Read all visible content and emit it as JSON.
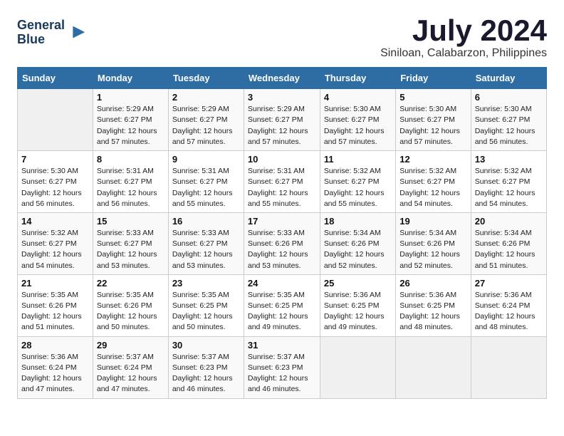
{
  "header": {
    "logo_line1": "General",
    "logo_line2": "Blue",
    "month": "July 2024",
    "location": "Siniloan, Calabarzon, Philippines"
  },
  "weekdays": [
    "Sunday",
    "Monday",
    "Tuesday",
    "Wednesday",
    "Thursday",
    "Friday",
    "Saturday"
  ],
  "weeks": [
    [
      {
        "day": "",
        "info": ""
      },
      {
        "day": "1",
        "info": "Sunrise: 5:29 AM\nSunset: 6:27 PM\nDaylight: 12 hours\nand 57 minutes."
      },
      {
        "day": "2",
        "info": "Sunrise: 5:29 AM\nSunset: 6:27 PM\nDaylight: 12 hours\nand 57 minutes."
      },
      {
        "day": "3",
        "info": "Sunrise: 5:29 AM\nSunset: 6:27 PM\nDaylight: 12 hours\nand 57 minutes."
      },
      {
        "day": "4",
        "info": "Sunrise: 5:30 AM\nSunset: 6:27 PM\nDaylight: 12 hours\nand 57 minutes."
      },
      {
        "day": "5",
        "info": "Sunrise: 5:30 AM\nSunset: 6:27 PM\nDaylight: 12 hours\nand 57 minutes."
      },
      {
        "day": "6",
        "info": "Sunrise: 5:30 AM\nSunset: 6:27 PM\nDaylight: 12 hours\nand 56 minutes."
      }
    ],
    [
      {
        "day": "7",
        "info": "Sunrise: 5:30 AM\nSunset: 6:27 PM\nDaylight: 12 hours\nand 56 minutes."
      },
      {
        "day": "8",
        "info": "Sunrise: 5:31 AM\nSunset: 6:27 PM\nDaylight: 12 hours\nand 56 minutes."
      },
      {
        "day": "9",
        "info": "Sunrise: 5:31 AM\nSunset: 6:27 PM\nDaylight: 12 hours\nand 55 minutes."
      },
      {
        "day": "10",
        "info": "Sunrise: 5:31 AM\nSunset: 6:27 PM\nDaylight: 12 hours\nand 55 minutes."
      },
      {
        "day": "11",
        "info": "Sunrise: 5:32 AM\nSunset: 6:27 PM\nDaylight: 12 hours\nand 55 minutes."
      },
      {
        "day": "12",
        "info": "Sunrise: 5:32 AM\nSunset: 6:27 PM\nDaylight: 12 hours\nand 54 minutes."
      },
      {
        "day": "13",
        "info": "Sunrise: 5:32 AM\nSunset: 6:27 PM\nDaylight: 12 hours\nand 54 minutes."
      }
    ],
    [
      {
        "day": "14",
        "info": "Sunrise: 5:32 AM\nSunset: 6:27 PM\nDaylight: 12 hours\nand 54 minutes."
      },
      {
        "day": "15",
        "info": "Sunrise: 5:33 AM\nSunset: 6:27 PM\nDaylight: 12 hours\nand 53 minutes."
      },
      {
        "day": "16",
        "info": "Sunrise: 5:33 AM\nSunset: 6:27 PM\nDaylight: 12 hours\nand 53 minutes."
      },
      {
        "day": "17",
        "info": "Sunrise: 5:33 AM\nSunset: 6:26 PM\nDaylight: 12 hours\nand 53 minutes."
      },
      {
        "day": "18",
        "info": "Sunrise: 5:34 AM\nSunset: 6:26 PM\nDaylight: 12 hours\nand 52 minutes."
      },
      {
        "day": "19",
        "info": "Sunrise: 5:34 AM\nSunset: 6:26 PM\nDaylight: 12 hours\nand 52 minutes."
      },
      {
        "day": "20",
        "info": "Sunrise: 5:34 AM\nSunset: 6:26 PM\nDaylight: 12 hours\nand 51 minutes."
      }
    ],
    [
      {
        "day": "21",
        "info": "Sunrise: 5:35 AM\nSunset: 6:26 PM\nDaylight: 12 hours\nand 51 minutes."
      },
      {
        "day": "22",
        "info": "Sunrise: 5:35 AM\nSunset: 6:26 PM\nDaylight: 12 hours\nand 50 minutes."
      },
      {
        "day": "23",
        "info": "Sunrise: 5:35 AM\nSunset: 6:25 PM\nDaylight: 12 hours\nand 50 minutes."
      },
      {
        "day": "24",
        "info": "Sunrise: 5:35 AM\nSunset: 6:25 PM\nDaylight: 12 hours\nand 49 minutes."
      },
      {
        "day": "25",
        "info": "Sunrise: 5:36 AM\nSunset: 6:25 PM\nDaylight: 12 hours\nand 49 minutes."
      },
      {
        "day": "26",
        "info": "Sunrise: 5:36 AM\nSunset: 6:25 PM\nDaylight: 12 hours\nand 48 minutes."
      },
      {
        "day": "27",
        "info": "Sunrise: 5:36 AM\nSunset: 6:24 PM\nDaylight: 12 hours\nand 48 minutes."
      }
    ],
    [
      {
        "day": "28",
        "info": "Sunrise: 5:36 AM\nSunset: 6:24 PM\nDaylight: 12 hours\nand 47 minutes."
      },
      {
        "day": "29",
        "info": "Sunrise: 5:37 AM\nSunset: 6:24 PM\nDaylight: 12 hours\nand 47 minutes."
      },
      {
        "day": "30",
        "info": "Sunrise: 5:37 AM\nSunset: 6:23 PM\nDaylight: 12 hours\nand 46 minutes."
      },
      {
        "day": "31",
        "info": "Sunrise: 5:37 AM\nSunset: 6:23 PM\nDaylight: 12 hours\nand 46 minutes."
      },
      {
        "day": "",
        "info": ""
      },
      {
        "day": "",
        "info": ""
      },
      {
        "day": "",
        "info": ""
      }
    ]
  ]
}
